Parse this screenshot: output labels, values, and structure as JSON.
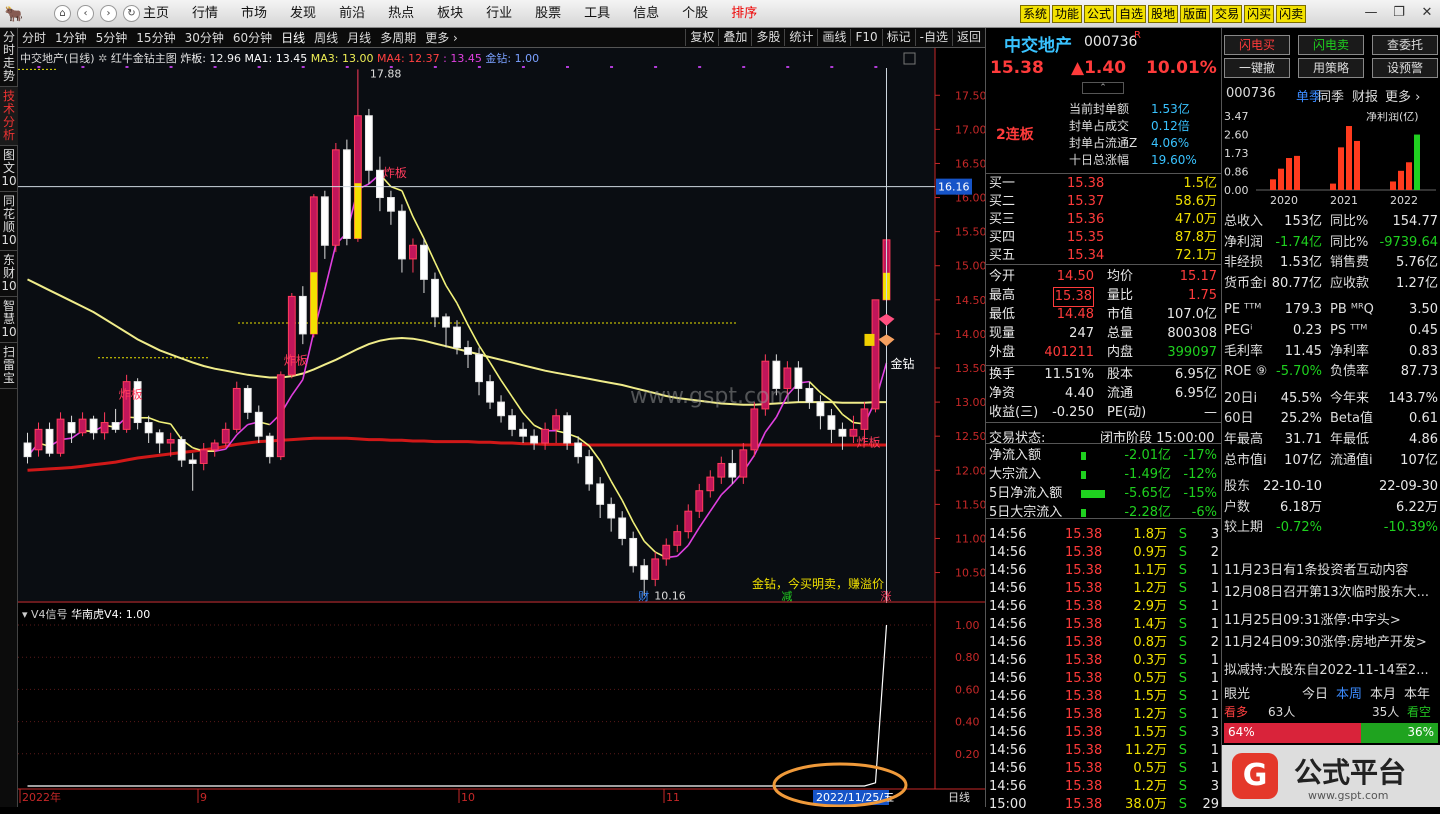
{
  "topbar": {
    "logo": "🐂",
    "nav": [
      "⌂",
      "‹",
      "›",
      "↻"
    ],
    "menu": [
      "主页",
      "行情",
      "市场",
      "发现",
      "前沿",
      "热点",
      "板块",
      "行业",
      "股票",
      "工具",
      "信息",
      "个股",
      "排序"
    ],
    "active_menu": "排序",
    "right_buttons": [
      "系统",
      "功能",
      "公式",
      "自选",
      "股地",
      "版面",
      "交易",
      "闪买",
      "闪卖"
    ],
    "window_controls": [
      "—",
      "❐",
      "✕"
    ]
  },
  "left_sidebar": [
    {
      "label": "分时走势",
      "active": false
    },
    {
      "label": "技术分析",
      "active": true
    },
    {
      "label": "图文10",
      "active": false
    },
    {
      "label": "同花顺10",
      "active": false
    },
    {
      "label": "东财10",
      "active": false
    },
    {
      "label": "智慧10",
      "active": false
    },
    {
      "label": "扫雷宝",
      "active": false
    }
  ],
  "toolbar": {
    "periods": [
      "分时",
      "1分钟",
      "5分钟",
      "15分钟",
      "30分钟",
      "60分钟",
      "日线",
      "周线",
      "月线",
      "多周期",
      "更多 ›"
    ],
    "active_period": "日线",
    "tools": [
      "复权",
      "叠加",
      "多股",
      "统计",
      "画线",
      "F10",
      "标记",
      "-自选",
      "返回"
    ]
  },
  "legend": {
    "title": "中交地产(日线)",
    "indicator": "红牛金钻主图",
    "zb": "炸板: 12.96",
    "ma1": "MA1: 13.45",
    "ma3": "MA3: 13.00",
    "ma4": "MA4: 12.37",
    "extra": ": 13.45",
    "jz": "金钻: 1.00"
  },
  "chart_data": {
    "type": "candlestick",
    "title": "中交地产(日线)",
    "ylim": [
      10.2,
      17.9
    ],
    "yticks": [
      10.5,
      11.0,
      11.5,
      12.0,
      12.5,
      13.0,
      13.5,
      14.0,
      14.5,
      15.0,
      15.5,
      16.0,
      16.5,
      17.0,
      17.5
    ],
    "crosshair_price": "16.16",
    "x_labels": [
      "2022年",
      "9",
      "10",
      "11"
    ],
    "date_label": "2022/11/25/五",
    "high_label": "17.88",
    "low_label": "10.16",
    "annotations": [
      "炸板",
      "炸板",
      "炸板",
      "炸板",
      "金钻",
      "金钻，今买明卖，赚溢价",
      "财",
      "减",
      "涨"
    ],
    "candles": [
      [
        12.4,
        12.2,
        12.55,
        12.1
      ],
      [
        12.3,
        12.6,
        12.7,
        12.2
      ],
      [
        12.6,
        12.25,
        12.7,
        12.2
      ],
      [
        12.25,
        12.75,
        12.85,
        12.2
      ],
      [
        12.7,
        12.55,
        12.8,
        12.4
      ],
      [
        12.55,
        12.75,
        12.85,
        12.5
      ],
      [
        12.75,
        12.55,
        12.8,
        12.45
      ],
      [
        12.55,
        12.7,
        12.85,
        12.45
      ],
      [
        12.7,
        12.6,
        12.9,
        12.55
      ],
      [
        12.6,
        13.3,
        13.4,
        12.55
      ],
      [
        13.3,
        12.7,
        13.35,
        12.6
      ],
      [
        12.7,
        12.55,
        12.8,
        12.4
      ],
      [
        12.55,
        12.4,
        12.6,
        12.25
      ],
      [
        12.4,
        12.45,
        12.55,
        12.2
      ],
      [
        12.45,
        12.15,
        12.5,
        12.05
      ],
      [
        12.15,
        12.1,
        12.25,
        11.7
      ],
      [
        12.1,
        12.3,
        12.4,
        12.0
      ],
      [
        12.3,
        12.4,
        12.45,
        12.2
      ],
      [
        12.4,
        12.6,
        12.7,
        12.35
      ],
      [
        12.6,
        13.2,
        13.3,
        12.55
      ],
      [
        13.2,
        12.85,
        13.25,
        12.75
      ],
      [
        12.85,
        12.5,
        12.95,
        12.4
      ],
      [
        12.5,
        12.2,
        12.55,
        12.1
      ],
      [
        12.2,
        13.4,
        13.45,
        12.15
      ],
      [
        13.4,
        14.55,
        14.6,
        13.35
      ],
      [
        14.55,
        14.0,
        14.7,
        13.85
      ],
      [
        14.0,
        16.01,
        16.05,
        13.95
      ],
      [
        16.01,
        15.3,
        16.1,
        15.1
      ],
      [
        15.3,
        16.7,
        16.8,
        15.2
      ],
      [
        16.7,
        15.4,
        16.85,
        15.3
      ],
      [
        15.4,
        17.2,
        17.88,
        15.35
      ],
      [
        17.2,
        16.4,
        17.3,
        16.2
      ],
      [
        16.4,
        16.0,
        16.6,
        15.8
      ],
      [
        16.0,
        15.8,
        16.1,
        15.6
      ],
      [
        15.8,
        15.1,
        15.9,
        14.9
      ],
      [
        15.1,
        15.3,
        15.4,
        14.9
      ],
      [
        15.3,
        14.8,
        15.4,
        14.6
      ],
      [
        14.8,
        14.25,
        14.9,
        14.1
      ],
      [
        14.25,
        14.1,
        14.3,
        13.8
      ],
      [
        14.1,
        13.8,
        14.2,
        13.7
      ],
      [
        13.8,
        13.7,
        13.9,
        13.5
      ],
      [
        13.7,
        13.3,
        13.8,
        13.1
      ],
      [
        13.3,
        13.0,
        13.4,
        12.9
      ],
      [
        13.0,
        12.8,
        13.1,
        12.7
      ],
      [
        12.8,
        12.6,
        12.9,
        12.5
      ],
      [
        12.6,
        12.5,
        12.7,
        12.4
      ],
      [
        12.5,
        12.4,
        12.6,
        12.3
      ],
      [
        12.4,
        12.6,
        12.7,
        12.3
      ],
      [
        12.6,
        12.8,
        12.9,
        12.4
      ],
      [
        12.8,
        12.4,
        12.85,
        12.3
      ],
      [
        12.4,
        12.2,
        12.5,
        12.1
      ],
      [
        12.2,
        11.8,
        12.3,
        11.7
      ],
      [
        11.8,
        11.5,
        11.9,
        11.3
      ],
      [
        11.5,
        11.3,
        11.6,
        11.1
      ],
      [
        11.3,
        11.0,
        11.4,
        10.9
      ],
      [
        11.0,
        10.6,
        11.1,
        10.5
      ],
      [
        10.6,
        10.4,
        10.7,
        10.16
      ],
      [
        10.4,
        10.7,
        10.8,
        10.3
      ],
      [
        10.7,
        10.9,
        11.0,
        10.6
      ],
      [
        10.9,
        11.1,
        11.2,
        10.8
      ],
      [
        11.1,
        11.4,
        11.5,
        11.0
      ],
      [
        11.4,
        11.7,
        11.8,
        11.3
      ],
      [
        11.7,
        11.9,
        12.0,
        11.6
      ],
      [
        11.9,
        12.1,
        12.2,
        11.8
      ],
      [
        12.1,
        11.9,
        12.3,
        11.8
      ],
      [
        11.9,
        12.3,
        12.4,
        11.8
      ],
      [
        12.3,
        12.9,
        13.0,
        12.2
      ],
      [
        12.9,
        13.6,
        13.7,
        12.8
      ],
      [
        13.6,
        13.2,
        13.7,
        13.1
      ],
      [
        13.2,
        13.5,
        13.6,
        13.1
      ],
      [
        13.5,
        13.2,
        13.6,
        13.0
      ],
      [
        13.2,
        13.0,
        13.3,
        12.9
      ],
      [
        13.0,
        12.8,
        13.1,
        12.6
      ],
      [
        12.8,
        12.6,
        12.9,
        12.4
      ],
      [
        12.6,
        12.5,
        12.7,
        12.3
      ],
      [
        12.5,
        12.6,
        12.8,
        12.4
      ],
      [
        12.6,
        12.9,
        13.0,
        12.4
      ],
      [
        12.9,
        14.5,
        14.5,
        12.85
      ],
      [
        14.5,
        15.38,
        15.38,
        14.48
      ]
    ],
    "ma_long": [
      12.0,
      12.01,
      12.02,
      12.03,
      12.04,
      12.06,
      12.08,
      12.1,
      12.12,
      12.15,
      12.18,
      12.2,
      12.22,
      12.24,
      12.26,
      12.28,
      12.3,
      12.32,
      12.35,
      12.38,
      12.4,
      12.42,
      12.43,
      12.44,
      12.45,
      12.46,
      12.47,
      12.47,
      12.47,
      12.47,
      12.46,
      12.45,
      12.45,
      12.44,
      12.44,
      12.43,
      12.43,
      12.42,
      12.42,
      12.42,
      12.42,
      12.41,
      12.41,
      12.4,
      12.4,
      12.39,
      12.39,
      12.38,
      12.38,
      12.38,
      12.38,
      12.37,
      12.37,
      12.37,
      12.37,
      12.37,
      12.37,
      12.37,
      12.37,
      12.37,
      12.37,
      12.37,
      12.37,
      12.37,
      12.37,
      12.37,
      12.37,
      12.37,
      12.37,
      12.37,
      12.37,
      12.37,
      12.37,
      12.37,
      12.37,
      12.37,
      12.37,
      12.37,
      12.37
    ],
    "ma_mid": [
      14.8,
      14.72,
      14.64,
      14.56,
      14.48,
      14.4,
      14.32,
      14.22,
      14.12,
      14.02,
      13.92,
      13.84,
      13.76,
      13.7,
      13.64,
      13.58,
      13.53,
      13.49,
      13.46,
      13.43,
      13.4,
      13.38,
      13.36,
      13.36,
      13.38,
      13.42,
      13.48,
      13.55,
      13.62,
      13.7,
      13.78,
      13.85,
      13.9,
      13.93,
      13.94,
      13.93,
      13.9,
      13.86,
      13.82,
      13.78,
      13.74,
      13.7,
      13.66,
      13.62,
      13.58,
      13.54,
      13.5,
      13.46,
      13.43,
      13.4,
      13.37,
      13.34,
      13.31,
      13.28,
      13.25,
      13.21,
      13.17,
      13.13,
      13.09,
      13.06,
      13.04,
      13.02,
      13.0,
      12.98,
      12.97,
      12.96,
      12.96,
      12.97,
      12.98,
      12.99,
      13.0,
      13.0,
      13.0,
      13.0,
      12.99,
      12.99,
      12.99,
      13.0,
      13.0
    ]
  },
  "sub_legend": {
    "title": "V4信号",
    "name": "华南虎V4: 1.00"
  },
  "sub_chart": {
    "ylim": [
      0,
      1.05
    ],
    "yticks": [
      "1.00",
      "0.80",
      "0.60",
      "0.40",
      "0.20"
    ],
    "values": [
      0,
      0,
      0,
      0,
      0,
      0,
      0,
      0,
      0,
      0,
      0,
      0,
      0,
      0,
      0,
      0,
      0,
      0,
      0,
      0,
      0,
      0,
      0,
      0,
      0,
      0,
      0,
      0,
      0,
      0,
      0,
      0,
      0,
      0,
      0,
      0,
      0,
      0,
      0,
      0,
      0,
      0,
      0,
      0,
      0,
      0,
      0,
      0,
      0,
      0,
      0,
      0,
      0,
      0,
      0,
      0,
      0,
      0,
      0,
      0,
      0,
      0,
      0,
      0,
      0,
      0,
      0,
      0,
      0,
      0,
      0,
      0,
      0,
      0,
      0,
      0,
      0,
      0.02,
      1.0
    ],
    "bottom_right": "日线",
    "watermark": "www.gspt.com"
  },
  "quote": {
    "name": "中交地产",
    "code": "000736",
    "mark": "R",
    "price": "15.38",
    "change": "▲1.40",
    "pct": "10.01%",
    "board": "2连板",
    "seal": [
      {
        "k": "当前封单额",
        "v": "1.53亿"
      },
      {
        "k": "封单占成交",
        "v": "0.12倍"
      },
      {
        "k": "封单占流通Z",
        "v": "4.06%"
      },
      {
        "k": "十日总涨幅",
        "v": "19.60%"
      }
    ],
    "bids": [
      {
        "k": "买一",
        "p": "15.38",
        "v": "1.5亿"
      },
      {
        "k": "买二",
        "p": "15.37",
        "v": "58.6万"
      },
      {
        "k": "买三",
        "p": "15.36",
        "v": "47.0万"
      },
      {
        "k": "买四",
        "p": "15.35",
        "v": "87.8万"
      },
      {
        "k": "买五",
        "p": "15.34",
        "v": "72.1万"
      }
    ],
    "stats": [
      [
        "今开",
        "14.50",
        "均价",
        "15.17"
      ],
      [
        "最高",
        "15.38",
        "量比",
        "1.75"
      ],
      [
        "最低",
        "14.48",
        "市值",
        "107.0亿"
      ],
      [
        "现量",
        "247",
        "总量",
        "800308"
      ],
      [
        "外盘",
        "401211",
        "内盘",
        "399097"
      ]
    ],
    "stats2": [
      [
        "换手",
        "11.51%",
        "股本",
        "6.95亿"
      ],
      [
        "净资",
        "4.40",
        "流通",
        "6.95亿"
      ],
      [
        "收益(三)",
        "-0.250",
        "PE(动)",
        "—"
      ]
    ],
    "status_label": "交易状态:",
    "status_value": "闭市阶段 15:00:00",
    "flows": [
      {
        "k": "净流入额",
        "v": "-2.01亿",
        "p": "-17%",
        "w": 0.2
      },
      {
        "k": "大宗流入",
        "v": "-1.49亿",
        "p": "-12%",
        "w": 0.2
      },
      {
        "k": "5日净流入额",
        "v": "-5.65亿",
        "p": "-15%",
        "w": 1
      },
      {
        "k": "5日大宗流入",
        "v": "-2.28亿",
        "p": "-6%",
        "w": 0.2
      }
    ],
    "ticks": [
      [
        "14:56",
        "15.38",
        "1.8万",
        "S",
        "3"
      ],
      [
        "14:56",
        "15.38",
        "0.9万",
        "S",
        "2"
      ],
      [
        "14:56",
        "15.38",
        "1.1万",
        "S",
        "1"
      ],
      [
        "14:56",
        "15.38",
        "1.2万",
        "S",
        "1"
      ],
      [
        "14:56",
        "15.38",
        "2.9万",
        "S",
        "1"
      ],
      [
        "14:56",
        "15.38",
        "1.4万",
        "S",
        "1"
      ],
      [
        "14:56",
        "15.38",
        "0.8万",
        "S",
        "2"
      ],
      [
        "14:56",
        "15.38",
        "0.3万",
        "S",
        "1"
      ],
      [
        "14:56",
        "15.38",
        "0.5万",
        "S",
        "1"
      ],
      [
        "14:56",
        "15.38",
        "1.5万",
        "S",
        "1"
      ],
      [
        "14:56",
        "15.38",
        "1.2万",
        "S",
        "1"
      ],
      [
        "14:56",
        "15.38",
        "1.5万",
        "S",
        "3"
      ],
      [
        "14:56",
        "15.38",
        "11.2万",
        "S",
        "1"
      ],
      [
        "14:56",
        "15.38",
        "0.5万",
        "S",
        "1"
      ],
      [
        "14:56",
        "15.38",
        "1.2万",
        "S",
        "3"
      ],
      [
        "15:00",
        "15.38",
        "38.0万",
        "S",
        "29"
      ]
    ]
  },
  "right": {
    "buttons": [
      "闪电买",
      "闪电卖",
      "查委托",
      "一键撤",
      "用策略",
      "设预警"
    ],
    "fin_tabs": [
      "000736",
      "单季",
      "同季",
      "财报",
      "更多 ›"
    ],
    "fin_chart": {
      "unit": "净利润(亿)",
      "yticks": [
        "3.47",
        "2.60",
        "1.73",
        "0.86",
        "0.00"
      ],
      "years": [
        "2020",
        "2021",
        "2022"
      ],
      "ylim": [
        0,
        3.47
      ],
      "bars": [
        [
          0.5,
          1.0,
          1.5,
          1.6
        ],
        [
          0.3,
          2.0,
          3.0,
          2.3
        ],
        [
          0.4,
          0.9,
          1.3,
          2.6
        ]
      ]
    },
    "fin": [
      [
        "总收入",
        "153亿",
        "同比%",
        "154.77"
      ],
      [
        "净利润",
        "-1.74亿",
        "同比%",
        "-9739.64"
      ],
      [
        "非经损",
        "1.53亿",
        "销售费",
        "5.76亿"
      ],
      [
        "货币金i",
        "80.77亿",
        "应收款",
        "1.27亿"
      ],
      [
        "PE ᵀᵀᴹ",
        "179.3",
        "PB ᴹᴿQ",
        "3.50"
      ],
      [
        "PEGⁱ",
        "0.23",
        "PS ᵀᵀᴹ",
        "0.45"
      ],
      [
        "毛利率",
        "11.45",
        "净利率",
        "0.83"
      ],
      [
        "ROE ⑨",
        "-5.70%",
        "负债率",
        "87.73"
      ],
      [
        "20日i",
        "45.5%",
        "今年来",
        "143.7%"
      ],
      [
        "60日",
        "25.2%",
        "Beta值",
        "0.61"
      ],
      [
        "年最高",
        "31.71",
        "年最低",
        "4.86"
      ],
      [
        "总市值i",
        "107亿",
        "流通值i",
        "107亿"
      ],
      [
        "股东",
        "22-10-10",
        "",
        "22-09-30"
      ],
      [
        "户数",
        "6.18万",
        "",
        "6.22万"
      ],
      [
        "较上期",
        "-0.72%",
        "",
        "-10.39%"
      ]
    ],
    "news": [
      "11月23日有1条投资者互动内容",
      "12月08日召开第13次临时股东大...",
      "11月25日09:31涨停:中字头>",
      "11月24日09:30涨停:房地产开发>",
      "拟减持:大股东自2022-11-14至2..."
    ],
    "eye_title": "眼光",
    "eye_tabs": [
      "今日",
      "本周",
      "本月",
      "本年"
    ],
    "bull": "看多",
    "bull_n": "63人",
    "bear_n": "35人",
    "bear": "看空",
    "bull_pct": "64%",
    "bear_pct": "36%",
    "brand": "公式平台",
    "brand_url": "www.gspt.com"
  }
}
